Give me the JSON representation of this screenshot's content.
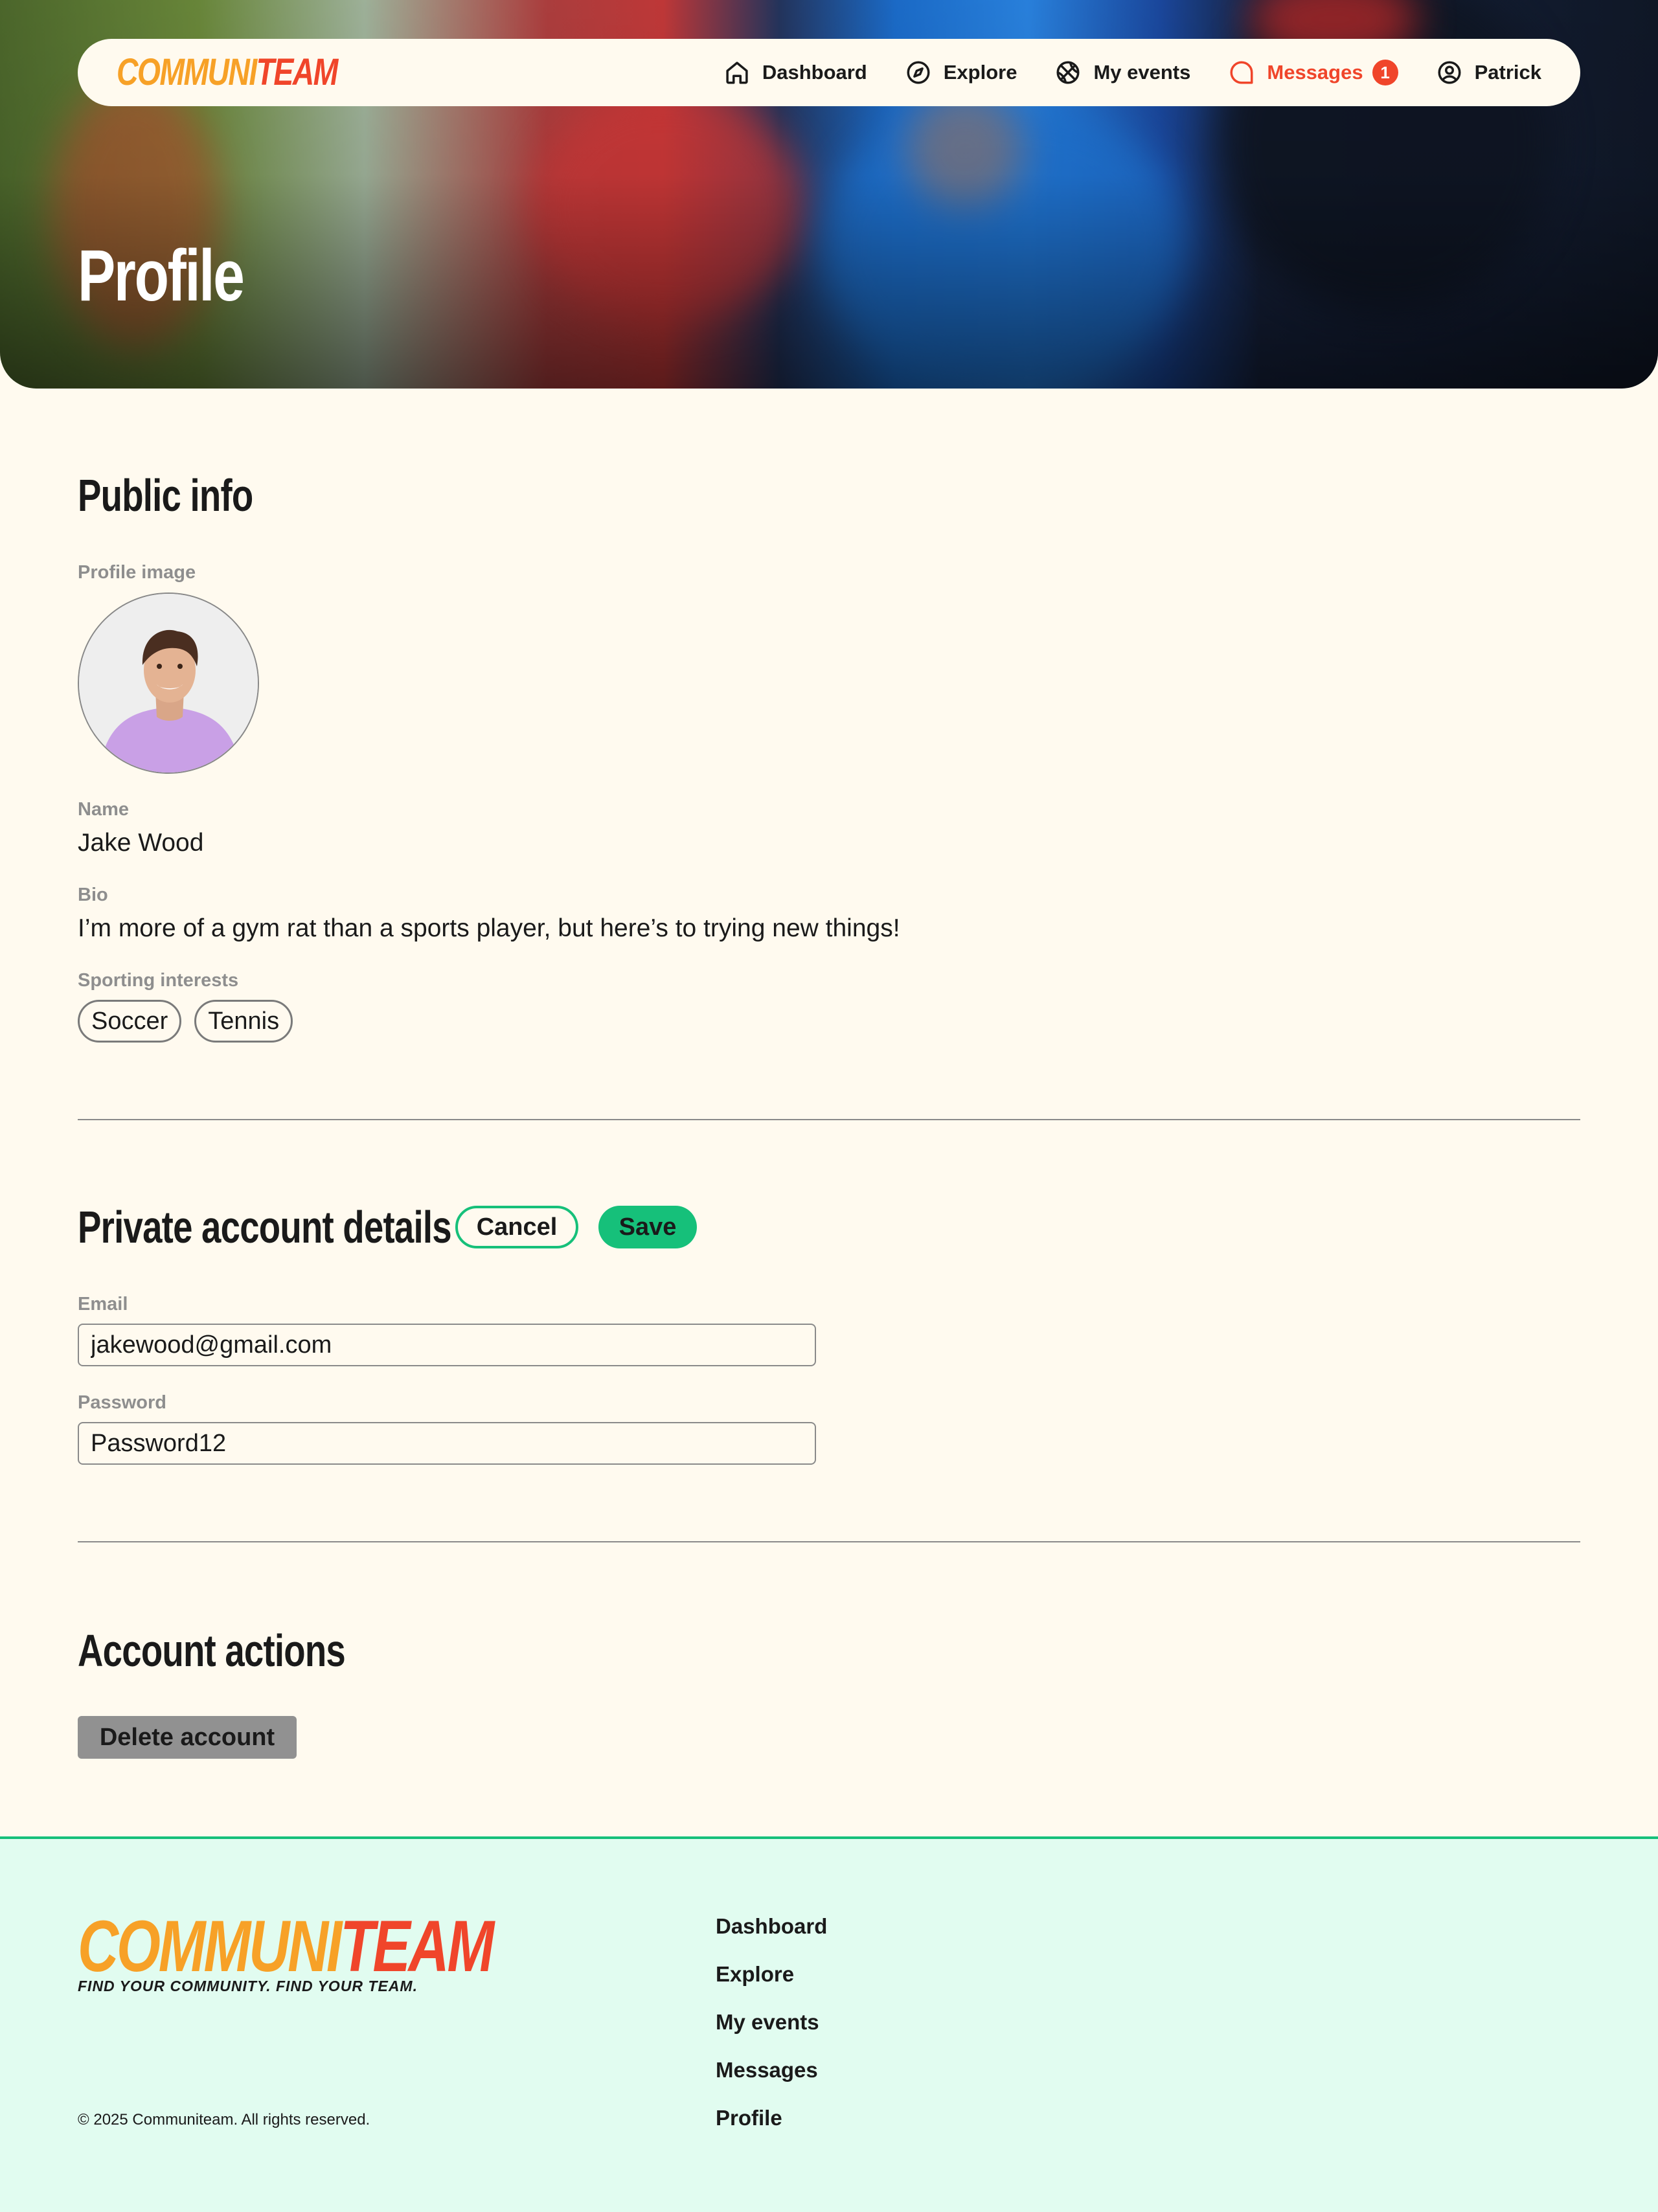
{
  "brand": {
    "logo_part1": "COMMUNI",
    "logo_part2": "TEAM",
    "tagline": "FIND YOUR COMMUNITY. FIND YOUR TEAM.",
    "primary_orange": "#F7A127",
    "primary_red": "#F0452A",
    "accent_green": "#16C07A"
  },
  "nav": {
    "items": [
      {
        "label": "Dashboard",
        "icon": "home-icon"
      },
      {
        "label": "Explore",
        "icon": "compass-icon"
      },
      {
        "label": "My events",
        "icon": "ball-icon"
      },
      {
        "label": "Messages",
        "icon": "chat-bubble-icon",
        "active": true,
        "badge": "1"
      },
      {
        "label": "Patrick",
        "icon": "user-circle-icon"
      }
    ]
  },
  "hero": {
    "title": "Profile"
  },
  "public_info": {
    "title": "Public info",
    "profile_image_label": "Profile image",
    "name_label": "Name",
    "name": "Jake Wood",
    "bio_label": "Bio",
    "bio": "I’m more of a gym rat than a sports player, but here’s to trying new things!",
    "interests_label": "Sporting interests",
    "interests": [
      "Soccer",
      "Tennis"
    ]
  },
  "private": {
    "title": "Private account details",
    "cancel_label": "Cancel",
    "save_label": "Save",
    "email_label": "Email",
    "email": "jakewood@gmail.com",
    "password_label": "Password",
    "password": "Password12"
  },
  "actions": {
    "title": "Account actions",
    "delete_label": "Delete account"
  },
  "footer": {
    "links": [
      "Dashboard",
      "Explore",
      "My events",
      "Messages",
      "Profile"
    ],
    "copyright": "© 2025 Communiteam. All rights reserved."
  }
}
